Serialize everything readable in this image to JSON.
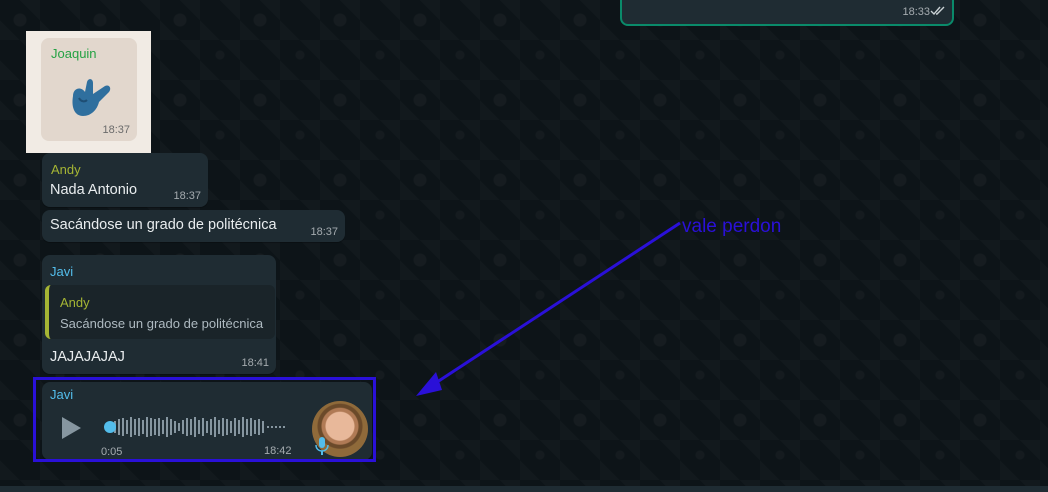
{
  "chat": {
    "outgoing_time": "18:33",
    "sticker": {
      "sender": "Joaquin",
      "time": "18:37"
    },
    "msg_andy_1": {
      "sender": "Andy",
      "text": "Nada Antonio",
      "time": "18:37"
    },
    "msg_andy_2": {
      "text": "Sacándose un grado de politécnica",
      "time": "18:37"
    },
    "msg_javi_reply": {
      "sender": "Javi",
      "quote_sender": "Andy",
      "quote_text": "Sacándose un grado de politécnica",
      "text": "JAJAJAJAJ",
      "time": "18:41"
    },
    "voice": {
      "sender": "Javi",
      "duration": "0:05",
      "time": "18:42"
    }
  },
  "annotation": {
    "text": "vale perdon",
    "color": "#2a10d8"
  },
  "colors": {
    "bubble": "#1f2c33",
    "joaquin": "#25a244",
    "andy": "#a5b534",
    "javi": "#53bdeb",
    "outgoing_border": "#0a8a6a"
  }
}
